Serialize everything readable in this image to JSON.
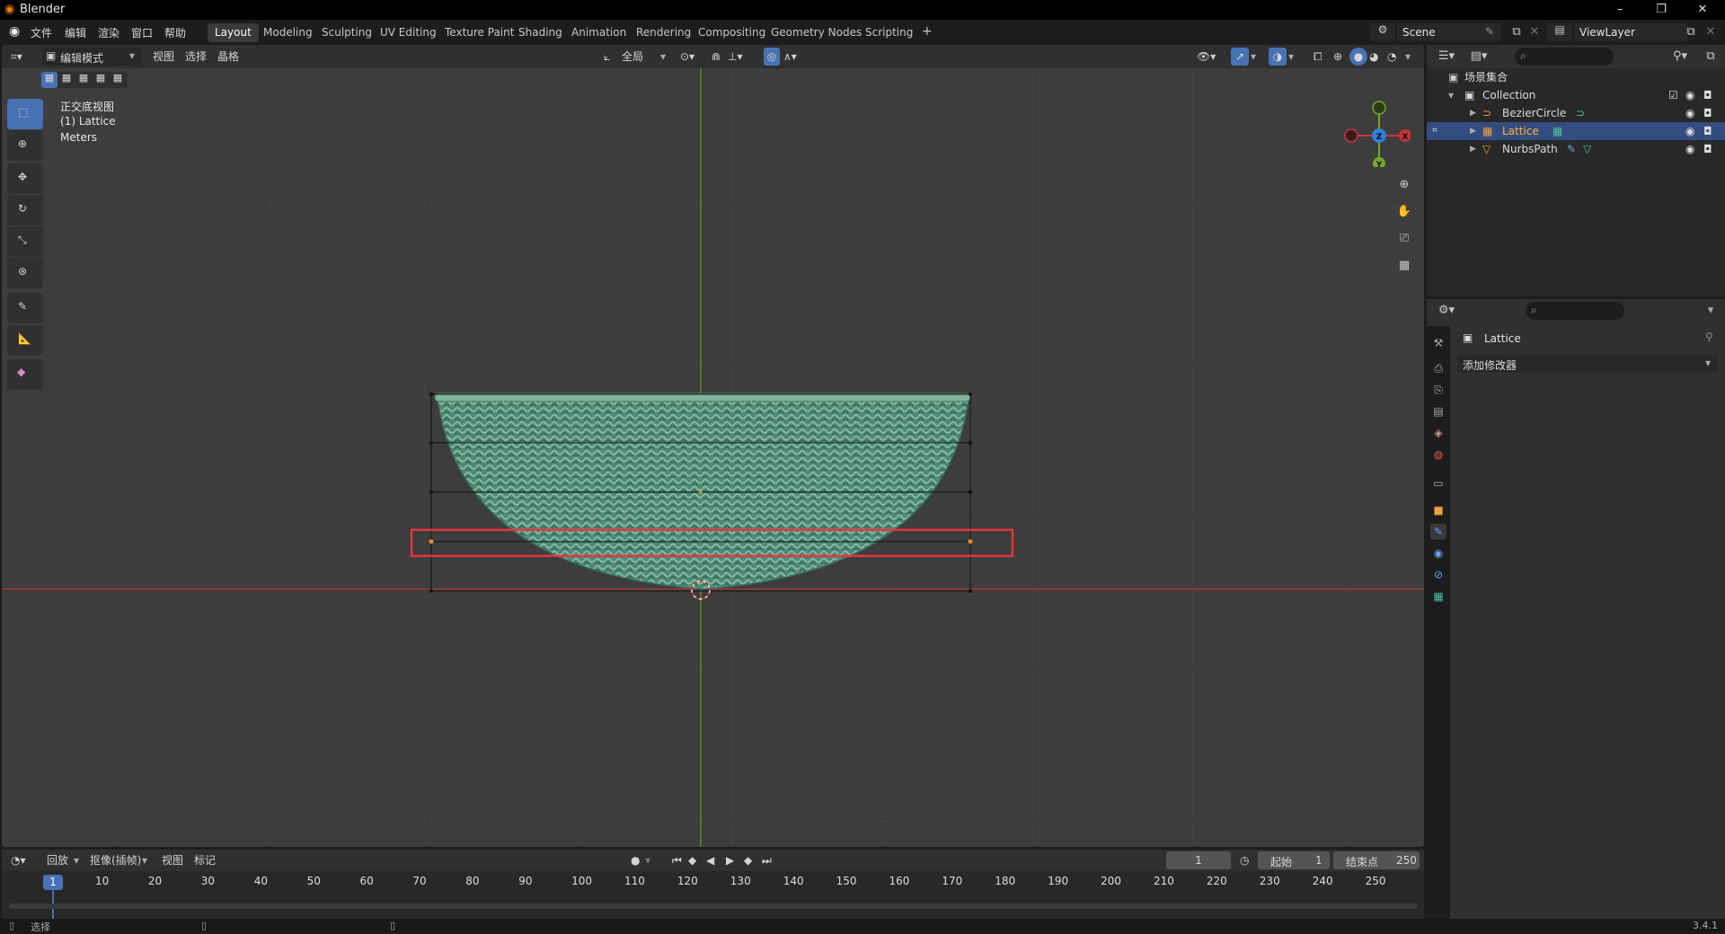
{
  "window": {
    "title": "Blender",
    "minimize": "–",
    "maximize": "❐",
    "close": "✕"
  },
  "menubar": {
    "items": [
      "文件",
      "编辑",
      "渲染",
      "窗口",
      "帮助"
    ]
  },
  "workspaces": [
    "Layout",
    "Modeling",
    "Sculpting",
    "UV Editing",
    "Texture Paint",
    "Shading",
    "Animation",
    "Rendering",
    "Compositing",
    "Geometry Nodes",
    "Scripting"
  ],
  "workspace_active": "Layout",
  "add_workspace": "+",
  "scene": {
    "name": "Scene",
    "view_layer": "ViewLayer"
  },
  "viewport_header": {
    "mode": "编辑模式",
    "menus": [
      "视图",
      "选择",
      "晶格"
    ],
    "orientation": "全局"
  },
  "viewport_info": {
    "view": "正交底视图",
    "object": "(1) Lattice",
    "units": "Meters"
  },
  "gizmo": {
    "x": "X",
    "y": "Y",
    "z": "Z"
  },
  "outliner": {
    "scene_collection": "场景集合",
    "collection": "Collection",
    "items": [
      {
        "name": "BezierCircle",
        "selected": false
      },
      {
        "name": "Lattice",
        "selected": true
      },
      {
        "name": "NurbsPath",
        "selected": false
      }
    ]
  },
  "properties": {
    "object_name": "Lattice",
    "add_modifier": "添加修改器"
  },
  "timeline": {
    "menus": [
      "回放",
      "抠像(插帧)",
      "视图",
      "标记"
    ],
    "current_frame": "1",
    "start_label": "起始",
    "start_value": "1",
    "end_label": "结束点",
    "end_value": "250",
    "marker_frame": "1",
    "ticks": [
      "10",
      "20",
      "30",
      "40",
      "50",
      "60",
      "70",
      "80",
      "90",
      "100",
      "110",
      "120",
      "130",
      "140",
      "150",
      "160",
      "170",
      "180",
      "190",
      "200",
      "210",
      "220",
      "230",
      "240",
      "250"
    ]
  },
  "statusbar": {
    "select_label": "选择",
    "version": "3.4.1"
  },
  "colors": {
    "accent": "#4772b3",
    "highlight_box": "#e8363a",
    "basket": "#5e9c84",
    "x_axis": "#c8363a",
    "y_axis": "#78a52a"
  }
}
